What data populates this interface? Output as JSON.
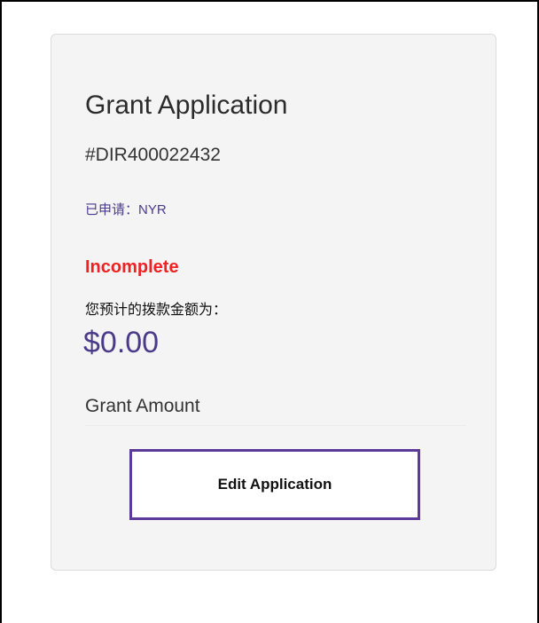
{
  "card": {
    "title": "Grant Application",
    "application_id": "#DIR400022432",
    "applied": "已申请：NYR",
    "status": "Incomplete",
    "estimate_label": "您预计的拨款金额为：",
    "amount": "$0.00",
    "grant_amount_label": "Grant Amount",
    "edit_button_label": "Edit Application"
  },
  "colors": {
    "accent": "#4b3a8a",
    "button_border": "#5b3a99",
    "status": "#ee2222",
    "card_background": "#f4f4f4"
  }
}
